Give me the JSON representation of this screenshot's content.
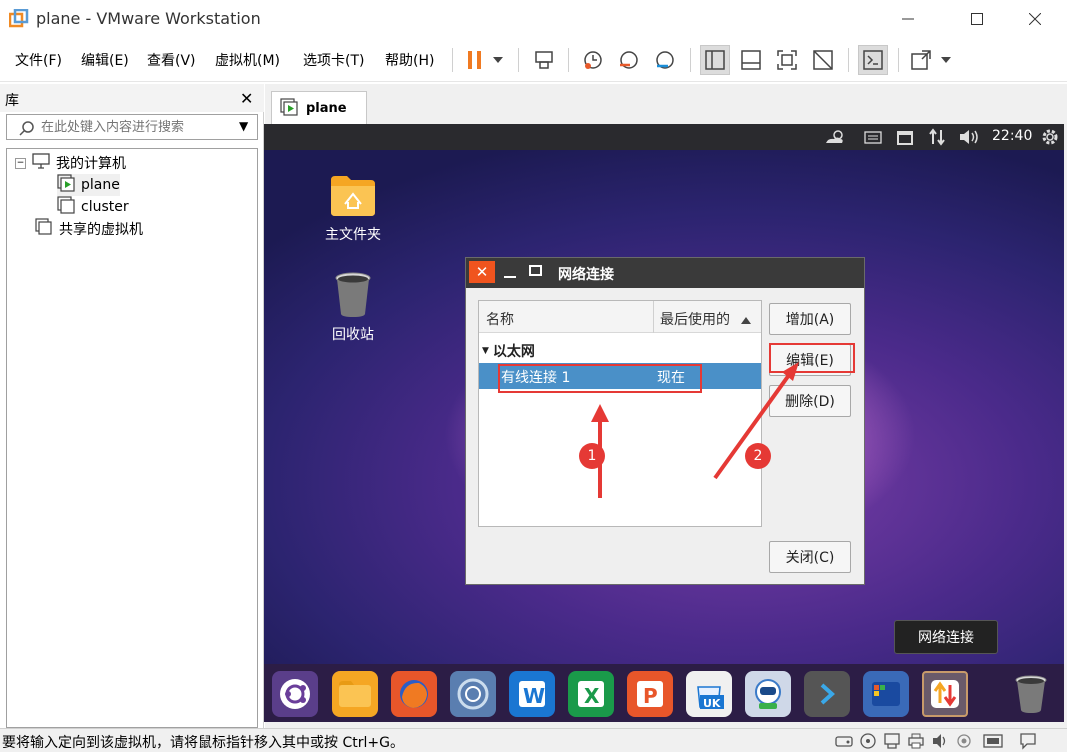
{
  "window": {
    "title": "plane - VMware Workstation"
  },
  "menu": {
    "items": [
      {
        "label": "文件(F)"
      },
      {
        "label": "编辑(E)"
      },
      {
        "label": "查看(V)"
      },
      {
        "label": "虚拟机(M)"
      },
      {
        "label": "选项卡(T)"
      },
      {
        "label": "帮助(H)"
      }
    ]
  },
  "library": {
    "title": "库",
    "search_placeholder": "在此处键入内容进行搜索",
    "tree": {
      "root": "我的计算机",
      "vms": [
        "plane",
        "cluster"
      ],
      "shared": "共享的虚拟机"
    }
  },
  "tab": {
    "label": "plane"
  },
  "guest": {
    "time": "22:40",
    "desktop_icons": [
      {
        "label": "主文件夹",
        "icon": "home-folder-icon"
      },
      {
        "label": "回收站",
        "icon": "trash-icon"
      }
    ],
    "dialog": {
      "title": "网络连接",
      "columns": [
        "名称",
        "最后使用的"
      ],
      "group": "以太网",
      "rows": [
        {
          "name": "有线连接 1",
          "last_used": "现在"
        }
      ],
      "buttons": {
        "add": "增加(A)",
        "edit": "编辑(E)",
        "delete": "删除(D)",
        "close": "关闭(C)"
      }
    },
    "tooltip": "网络连接",
    "annotations": [
      "1",
      "2"
    ]
  },
  "statusbar": {
    "text": "要将输入定向到该虚拟机，请将鼠标指针移入其中或按 Ctrl+G。"
  },
  "colors": {
    "accent_red": "#e53935",
    "dialog_close": "#f0541e",
    "selection": "#4a90c8"
  }
}
